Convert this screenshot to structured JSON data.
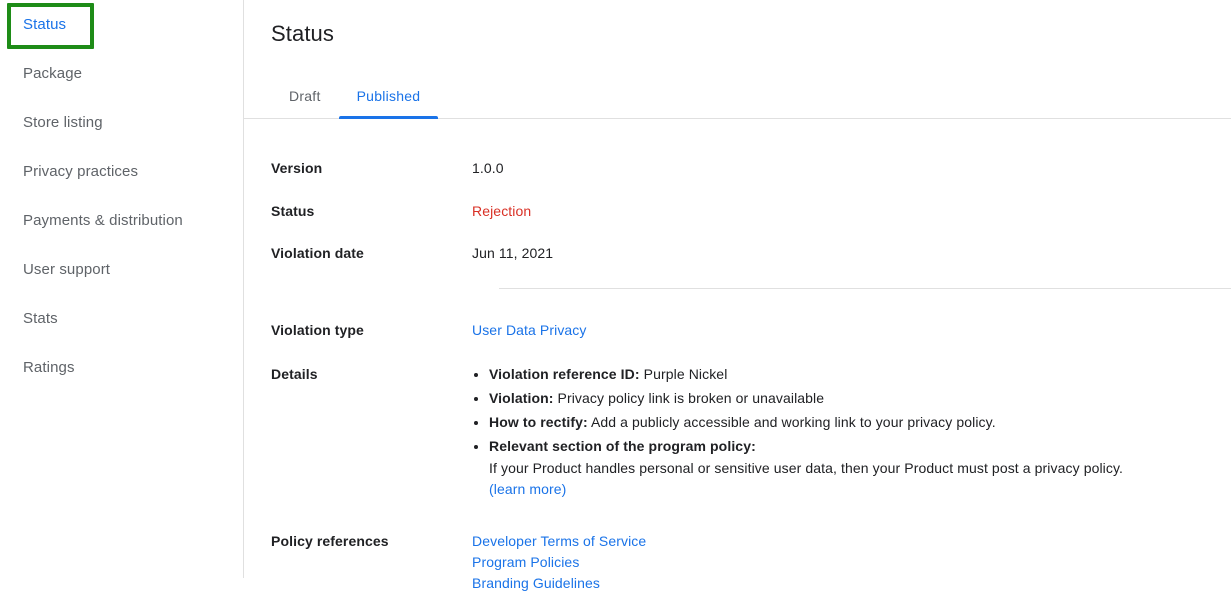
{
  "sidebar": {
    "items": [
      {
        "label": "Status",
        "active": true,
        "highlighted": true
      },
      {
        "label": "Package",
        "active": false,
        "highlighted": false
      },
      {
        "label": "Store listing",
        "active": false,
        "highlighted": false
      },
      {
        "label": "Privacy practices",
        "active": false,
        "highlighted": false
      },
      {
        "label": "Payments & distribution",
        "active": false,
        "highlighted": false
      },
      {
        "label": "User support",
        "active": false,
        "highlighted": false
      },
      {
        "label": "Stats",
        "active": false,
        "highlighted": false
      },
      {
        "label": "Ratings",
        "active": false,
        "highlighted": false
      }
    ],
    "highlight_color": "#1e8c17"
  },
  "main": {
    "title": "Status",
    "tabs": [
      {
        "label": "Draft",
        "selected": false
      },
      {
        "label": "Published",
        "selected": true
      }
    ],
    "accent_color": "#1a73e8",
    "rows": {
      "version": {
        "label": "Version",
        "value": "1.0.0"
      },
      "status": {
        "label": "Status",
        "value": "Rejection",
        "value_color": "#d93025"
      },
      "violation_date": {
        "label": "Violation date",
        "value": "Jun 11, 2021"
      },
      "violation_type": {
        "label": "Violation type",
        "value": "User Data Privacy"
      },
      "details": {
        "label": "Details",
        "bullets": [
          {
            "term": "Violation reference ID:",
            "text": " Purple Nickel"
          },
          {
            "term": "Violation:",
            "text": " Privacy policy link is broken or unavailable"
          },
          {
            "term": "How to rectify:",
            "text": " Add a publicly accessible and working link to your privacy policy."
          },
          {
            "term": "Relevant section of the program policy:",
            "text": "",
            "sub_text": "If your Product handles personal or sensitive user data, then your Product must post a privacy policy.",
            "sub_link": "(learn more)"
          }
        ]
      },
      "policy_references": {
        "label": "Policy references",
        "links": [
          "Developer Terms of Service",
          "Program Policies",
          "Branding Guidelines"
        ]
      }
    }
  }
}
